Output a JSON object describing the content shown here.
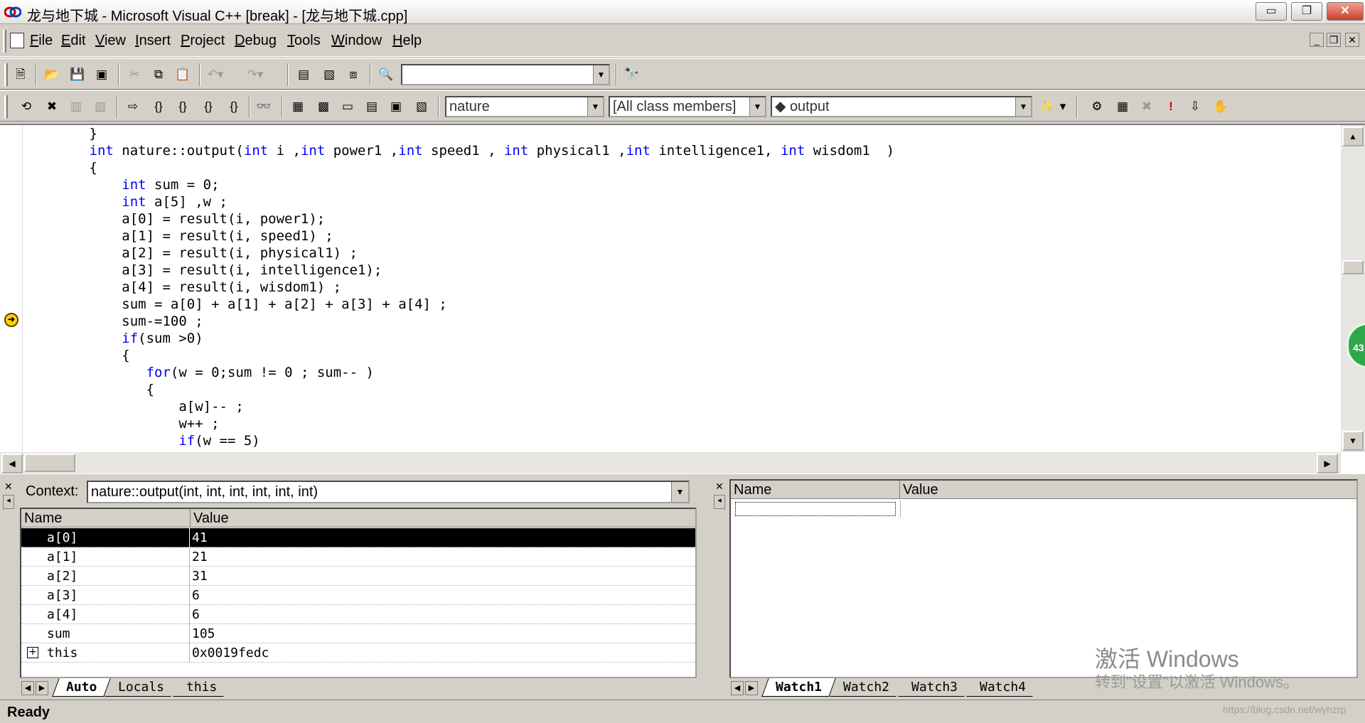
{
  "window": {
    "title": "龙与地下城 - Microsoft Visual C++ [break] - [龙与地下城.cpp]",
    "minimize": "▭",
    "maximize": "❐",
    "close": "✕"
  },
  "menu": {
    "items": [
      {
        "key": "F",
        "rest": "ile"
      },
      {
        "key": "E",
        "rest": "dit"
      },
      {
        "key": "V",
        "rest": "iew"
      },
      {
        "key": "I",
        "rest": "nsert"
      },
      {
        "key": "P",
        "rest": "roject"
      },
      {
        "key": "D",
        "rest": "ebug"
      },
      {
        "key": "T",
        "rest": "ools"
      },
      {
        "key": "W",
        "rest": "indow"
      },
      {
        "key": "H",
        "rest": "elp"
      }
    ],
    "mdi_min": "_",
    "mdi_restore": "❐",
    "mdi_close": "✕"
  },
  "toolbar2": {
    "class_combo": "nature",
    "filter_combo": "[All class members]",
    "member_combo": "◆ output"
  },
  "editor": {
    "lines": [
      [
        {
          "t": "        }"
        }
      ],
      [
        {
          "t": "        "
        },
        {
          "t": "int",
          "k": 1
        },
        {
          "t": " nature::output("
        },
        {
          "t": "int",
          "k": 1
        },
        {
          "t": " i ,"
        },
        {
          "t": "int",
          "k": 1
        },
        {
          "t": " power1 ,"
        },
        {
          "t": "int",
          "k": 1
        },
        {
          "t": " speed1 , "
        },
        {
          "t": "int",
          "k": 1
        },
        {
          "t": " physical1 ,"
        },
        {
          "t": "int",
          "k": 1
        },
        {
          "t": " intelligence1, "
        },
        {
          "t": "int",
          "k": 1
        },
        {
          "t": " wisdom1  )"
        }
      ],
      [
        {
          "t": "        {"
        }
      ],
      [
        {
          "t": "            "
        },
        {
          "t": "int",
          "k": 1
        },
        {
          "t": " sum = 0;"
        }
      ],
      [
        {
          "t": "            "
        },
        {
          "t": "int",
          "k": 1
        },
        {
          "t": " a[5] ,w ;"
        }
      ],
      [
        {
          "t": "            a[0] = result(i, power1);"
        }
      ],
      [
        {
          "t": "            a[1] = result(i, speed1) ;"
        }
      ],
      [
        {
          "t": "            a[2] = result(i, physical1) ;"
        }
      ],
      [
        {
          "t": "            a[3] = result(i, intelligence1);"
        }
      ],
      [
        {
          "t": "            a[4] = result(i, wisdom1) ;"
        }
      ],
      [
        {
          "t": "            sum = a[0] + a[1] + a[2] + a[3] + a[4] ;"
        }
      ],
      [
        {
          "t": "            sum-=100 ;"
        }
      ],
      [
        {
          "t": "            "
        },
        {
          "t": "if",
          "k": 1
        },
        {
          "t": "(sum >0)"
        }
      ],
      [
        {
          "t": "            {"
        }
      ],
      [
        {
          "t": "               "
        },
        {
          "t": "for",
          "k": 1
        },
        {
          "t": "(w = 0;sum != 0 ; sum-- )"
        }
      ],
      [
        {
          "t": "               {"
        }
      ],
      [
        {
          "t": "                   a[w]-- ;"
        }
      ],
      [
        {
          "t": "                   w++ ;"
        }
      ],
      [
        {
          "t": "                   "
        },
        {
          "t": "if",
          "k": 1
        },
        {
          "t": "(w == 5)"
        }
      ]
    ],
    "badge": "43"
  },
  "variables": {
    "context_label": "Context:",
    "context_value": "nature::output(int, int, int, int, int, int)",
    "col_name": "Name",
    "col_value": "Value",
    "rows": [
      {
        "name": "a[0]",
        "value": "41"
      },
      {
        "name": "a[1]",
        "value": "21"
      },
      {
        "name": "a[2]",
        "value": "31"
      },
      {
        "name": "a[3]",
        "value": "6"
      },
      {
        "name": "a[4]",
        "value": "6"
      },
      {
        "name": "sum",
        "value": "105"
      },
      {
        "name": "this",
        "value": "0x0019fedc"
      }
    ],
    "tabs": [
      "Auto",
      "Locals",
      "this"
    ]
  },
  "watch": {
    "col_name": "Name",
    "col_value": "Value",
    "tabs": [
      "Watch1",
      "Watch2",
      "Watch3",
      "Watch4"
    ]
  },
  "status": {
    "text": "Ready"
  },
  "watermark": {
    "line1": "激活 Windows",
    "line2": "转到\"设置\"以激活 Windows。",
    "url": "https://blog.csdn.net/wyhzrp"
  },
  "colors": {
    "keyword": "#0000ff",
    "selection": "#000000",
    "chrome": "#d4d0c8"
  }
}
